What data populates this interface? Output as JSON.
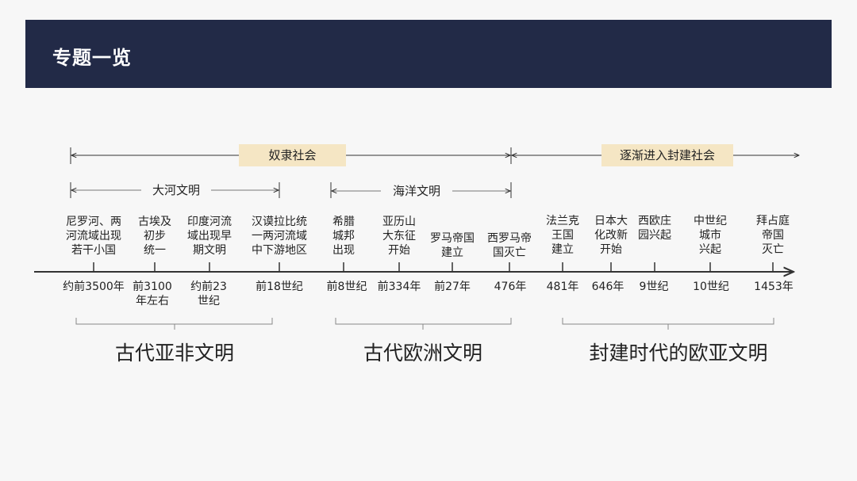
{
  "header": {
    "title": "专题一览"
  },
  "eras": [
    {
      "label": "奴隶社会"
    },
    {
      "label": "逐渐进入封建社会"
    }
  ],
  "sub_eras": [
    {
      "label": "大河文明"
    },
    {
      "label": "海洋文明"
    }
  ],
  "events": [
    {
      "lines": [
        "尼罗河、两",
        "河流域出现",
        "若干小国"
      ],
      "date": [
        "约前3500年"
      ]
    },
    {
      "lines": [
        "古埃及",
        "初步",
        "统一"
      ],
      "date": [
        "前3100",
        "年左右"
      ]
    },
    {
      "lines": [
        "印度河流",
        "域出现早",
        "期文明"
      ],
      "date": [
        "约前23",
        "世纪"
      ]
    },
    {
      "lines": [
        "汉谟拉比统",
        "一两河流域",
        "中下游地区"
      ],
      "date": [
        "前18世纪"
      ]
    },
    {
      "lines": [
        "希腊",
        "城邦",
        "出现"
      ],
      "date": [
        "前8世纪"
      ]
    },
    {
      "lines": [
        "亚历山",
        "大东征",
        "开始"
      ],
      "date": [
        "前334年"
      ]
    },
    {
      "lines": [
        "罗马帝国",
        "建立"
      ],
      "date": [
        "前27年"
      ]
    },
    {
      "lines": [
        "西罗马帝",
        "国灭亡"
      ],
      "date": [
        "476年"
      ]
    },
    {
      "lines": [
        "法兰克",
        "王国",
        "建立"
      ],
      "date": [
        "481年"
      ]
    },
    {
      "lines": [
        "日本大",
        "化改新",
        "开始"
      ],
      "date": [
        "646年"
      ]
    },
    {
      "lines": [
        "西欧庄",
        "园兴起"
      ],
      "date": [
        "9世纪"
      ]
    },
    {
      "lines": [
        "中世纪",
        "城市",
        "兴起"
      ],
      "date": [
        "10世纪"
      ]
    },
    {
      "lines": [
        "拜占庭",
        "帝国",
        "灭亡"
      ],
      "date": [
        "1453年"
      ]
    }
  ],
  "groups": [
    {
      "label": "古代亚非文明"
    },
    {
      "label": "古代欧洲文明"
    },
    {
      "label": "封建时代的欧亚文明"
    }
  ],
  "colors": {
    "header_bg": "#222a47",
    "tag_bg": "#f5e6c4",
    "line": "#333333"
  }
}
